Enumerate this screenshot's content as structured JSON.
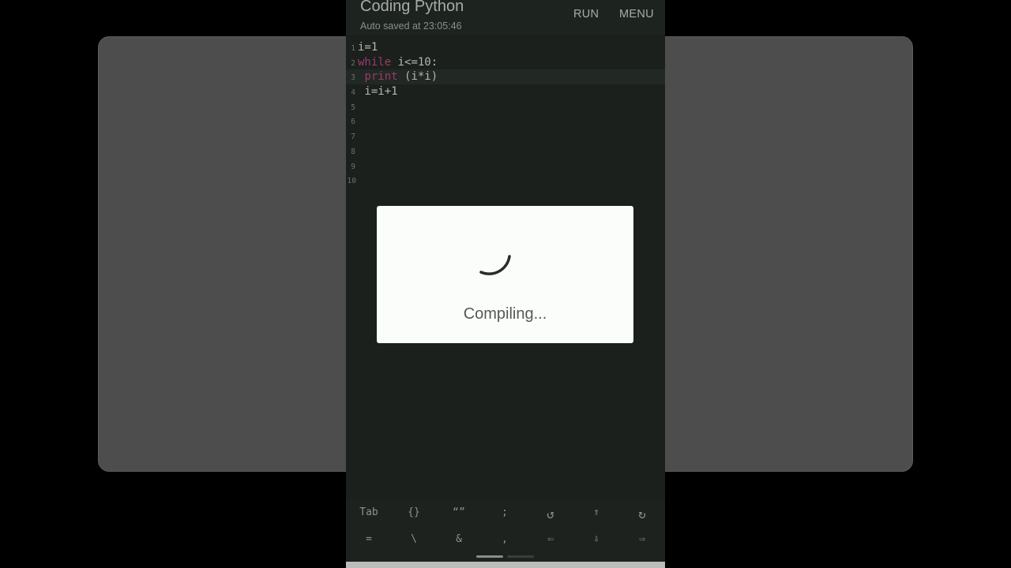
{
  "appbar": {
    "title": "Coding Python",
    "subtitle": "Auto saved at 23:05:46",
    "run_label": "RUN",
    "menu_label": "MENU"
  },
  "editor": {
    "line_numbers": [
      "1",
      "2",
      "3",
      "4",
      "5",
      "6",
      "7",
      "8",
      "9",
      "10"
    ],
    "lines": {
      "l1": "i=1",
      "l2_kw": "while",
      "l2_rest": " i<=10:",
      "l3_indent": " ",
      "l3_kw": "print",
      "l3_rest": " (i*i)",
      "l4": " i=i+1"
    }
  },
  "dialog": {
    "message": "Compiling..."
  },
  "keys": {
    "row1": [
      "Tab",
      "{}",
      "“”",
      ";",
      "↺",
      "⇑",
      "↻"
    ],
    "row2": [
      "=",
      "\\",
      "&",
      ",",
      "⇦",
      "⇩",
      "⇨"
    ]
  },
  "colors": {
    "background_card": "#4d4d4d",
    "editor_bg": "#1b201c",
    "keyword": "#9b3a6e",
    "dialog_bg": "#fbfdfa"
  }
}
